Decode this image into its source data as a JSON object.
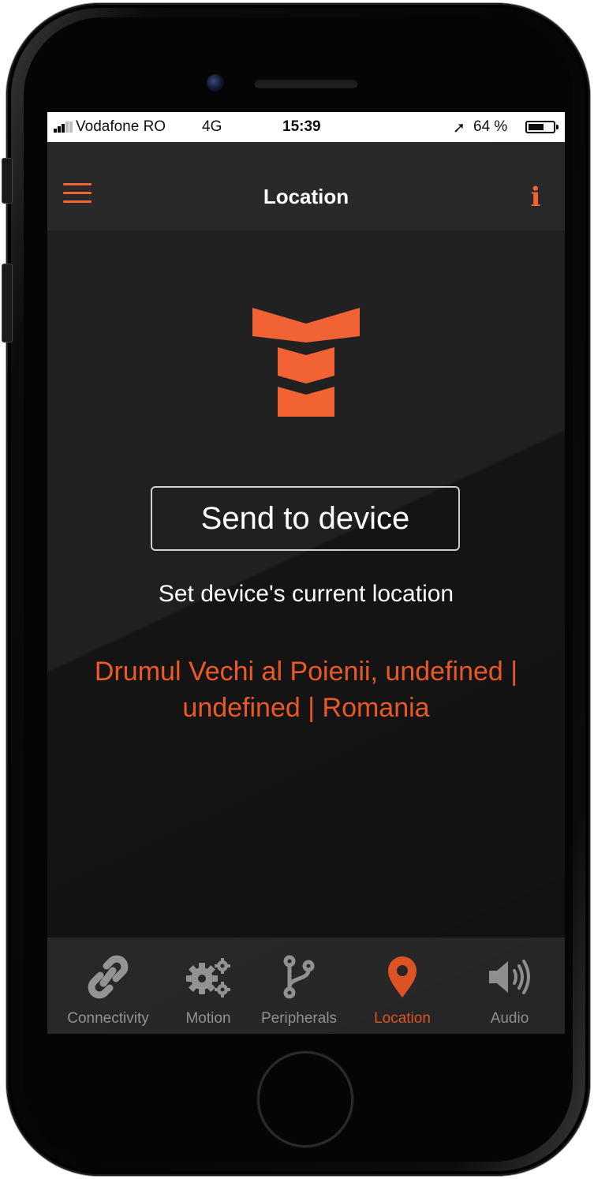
{
  "status_bar": {
    "carrier": "Vodafone RO",
    "network": "4G",
    "time": "15:39",
    "battery_percent": "64 %",
    "battery_level": 0.64,
    "location_arrow": "location-arrow-icon"
  },
  "header": {
    "title": "Location",
    "menu_icon": "hamburger-menu-icon",
    "info_label": "i"
  },
  "main": {
    "logo_icon": "brand-logo",
    "send_button_label": "Send to device",
    "hint": "Set device's current location",
    "address": "Drumul Vechi al Poienii, undefined | undefined | Romania"
  },
  "tabs": [
    {
      "label": "Connectivity",
      "icon": "link-icon",
      "active": false
    },
    {
      "label": "Motion",
      "icon": "gears-icon",
      "active": false
    },
    {
      "label": "Peripherals",
      "icon": "branch-icon",
      "active": false
    },
    {
      "label": "Location",
      "icon": "map-pin-icon",
      "active": true
    },
    {
      "label": "Audio",
      "icon": "speaker-icon",
      "active": false
    }
  ],
  "colors": {
    "accent": "#f05a28",
    "background": "#141414",
    "header": "#1c1c1c",
    "tab_bar": "#2a2a2a",
    "tab_inactive": "#9c9c9c"
  }
}
